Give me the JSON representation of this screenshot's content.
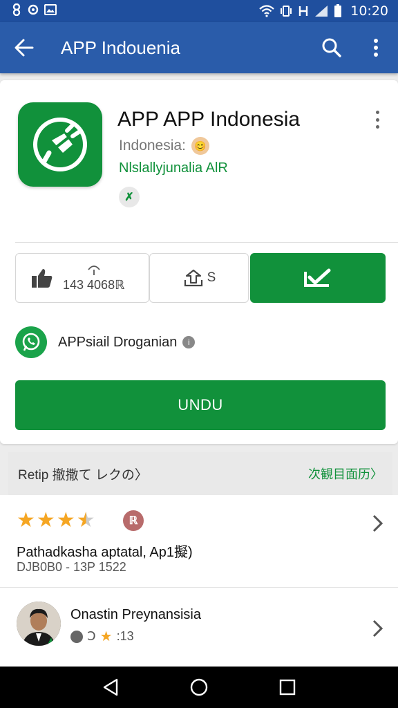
{
  "status_bar": {
    "left_icons": [
      "notification-icon",
      "notification-icon",
      "image-icon"
    ],
    "right_icons": [
      "wifi-icon",
      "vibrate-icon",
      "data-icon",
      "signal-icon",
      "battery-icon"
    ],
    "time": "10:20"
  },
  "app_bar": {
    "title": "APP Indouenia",
    "icons": [
      "back-arrow-icon",
      "search-icon",
      "more-vert-icon"
    ]
  },
  "app": {
    "name": "APP APP Indonesia",
    "subtitle": "Indonesia:",
    "developer": "Nlslallyjunalia AlR",
    "badge": "✗",
    "like_count": "143 4068ℝ",
    "share_label": "S",
    "messenger_label": "APPsiail Droganian",
    "download_label": "UNDU"
  },
  "reviews": {
    "header_title": "Retip 撤撒て レクの〉",
    "header_link": "次観目面历〉",
    "items": [
      {
        "rating": 3.5,
        "badge": "ℝ",
        "title": "Pathadkasha aptatal, Ap1擬)",
        "meta": "DJB0B0 - 13P 1522"
      },
      {
        "name": "Onastin Preynansisia",
        "meta_left": "Ↄ",
        "meta_right": ":13"
      }
    ]
  },
  "colors": {
    "status_bar": "#1f4f9e",
    "app_bar": "#2a5caa",
    "accent_green": "#11913b",
    "star": "#f5a623"
  }
}
